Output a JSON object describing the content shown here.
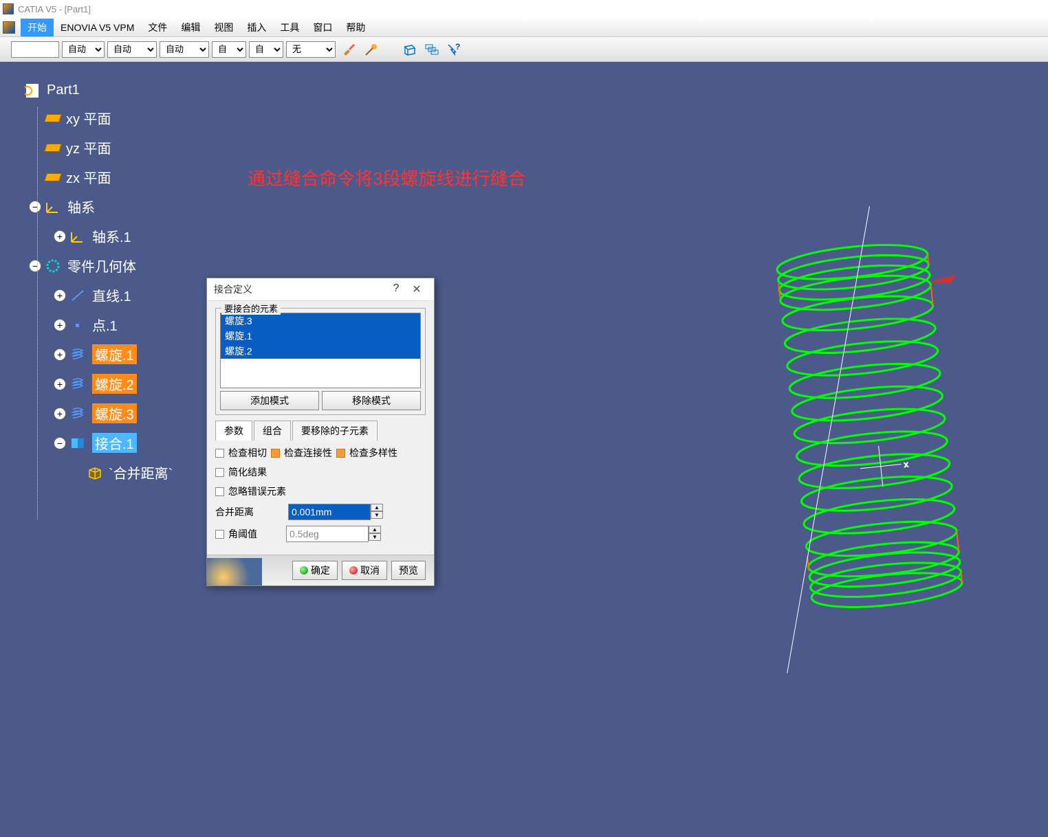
{
  "title": "CATIA V5 - [Part1]",
  "menu": {
    "start": "开始",
    "enovia": "ENOVIA V5 VPM",
    "file": "文件",
    "edit": "编辑",
    "view": "视图",
    "insert": "插入",
    "tools": "工具",
    "window": "窗口",
    "help": "帮助"
  },
  "toolbar": {
    "auto1": "自动",
    "auto2": "自动",
    "auto3": "自动",
    "auto4": "自",
    "auto5": "自",
    "none": "无"
  },
  "tree": {
    "root": "Part1",
    "xy": "xy 平面",
    "yz": "yz 平面",
    "zx": "zx 平面",
    "axis_sys": "轴系",
    "axis1": "轴系.1",
    "body": "零件几何体",
    "line1": "直线.1",
    "point1": "点.1",
    "helix1": "螺旋.1",
    "helix2": "螺旋.2",
    "helix3": "螺旋.3",
    "join1": "接合.1",
    "merge": "`合并距离`"
  },
  "annotation": "通过缝合命令将3段螺旋线进行缝合",
  "dialog": {
    "title": "接合定义",
    "help": "?",
    "close": "✕",
    "group_label": "要接合的元素",
    "items": [
      "螺旋.3",
      "螺旋.1",
      "螺旋.2"
    ],
    "add_mode": "添加模式",
    "remove_mode": "移除模式",
    "tab_params": "参数",
    "tab_combine": "组合",
    "tab_subremove": "要移除的子元素",
    "chk_tangent": "检查相切",
    "chk_connect": "检查连接性",
    "chk_manifold": "检查多样性",
    "chk_simplify": "简化结果",
    "chk_ignore": "忽略错误元素",
    "merge_dist_label": "合并距离",
    "merge_dist_val": "0.001mm",
    "angle_label": "角阈值",
    "angle_val": "0.5deg",
    "ok": "确定",
    "cancel": "取消",
    "preview": "预览"
  }
}
